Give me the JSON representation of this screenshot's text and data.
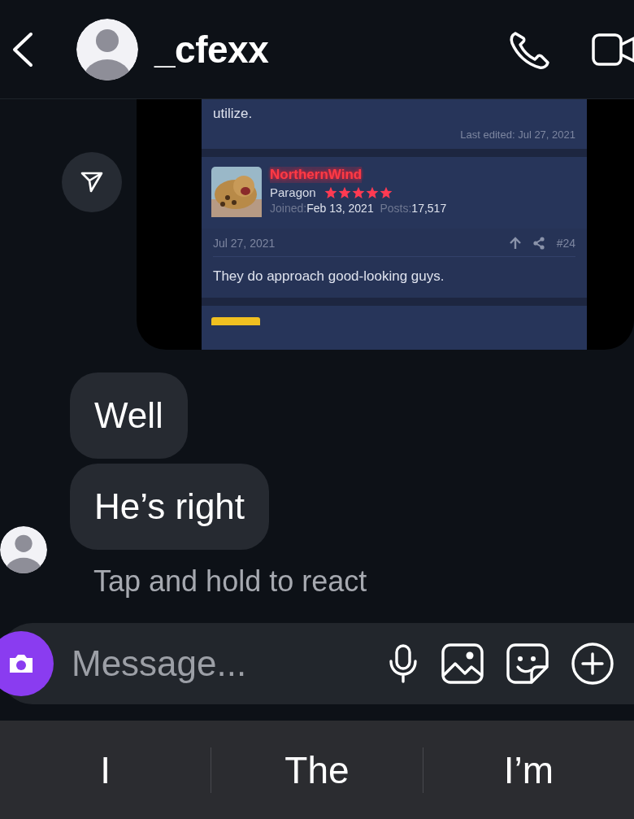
{
  "header": {
    "username": "_cfexx"
  },
  "shared_post": {
    "previous_post": {
      "text_end": "utilize.",
      "last_edited": "Last edited: Jul 27, 2021"
    },
    "post": {
      "author": "NorthernWind",
      "rank": "Paragon",
      "stars": 5,
      "joined_label": "Joined:",
      "joined": "Feb 13, 2021",
      "posts_label": "Posts:",
      "posts": "17,517",
      "date": "Jul 27, 2021",
      "number": "#24",
      "text": "They do approach good-looking guys."
    }
  },
  "messages": [
    {
      "text": "Well"
    },
    {
      "text": "He’s right"
    }
  ],
  "hint": "Tap and hold to react",
  "composer": {
    "placeholder": "Message..."
  },
  "suggestions": [
    "I",
    "The",
    "I’m"
  ]
}
